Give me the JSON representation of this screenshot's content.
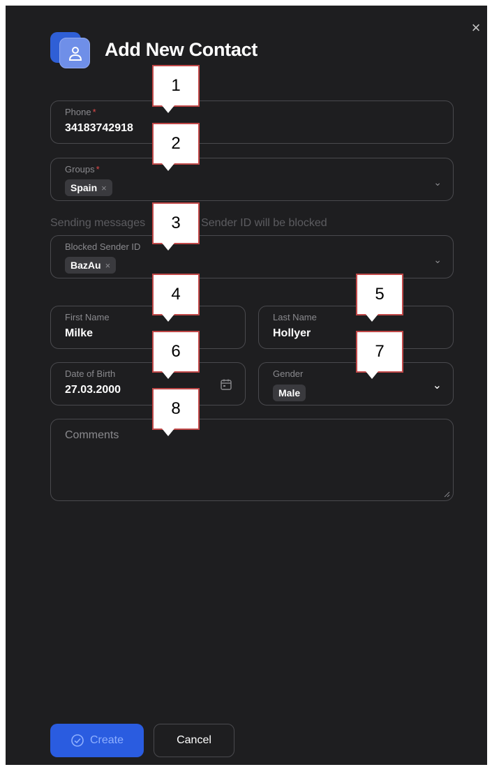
{
  "dialog": {
    "title": "Add New Contact",
    "close_glyph": "×",
    "logo_icon": "contact-user-icon"
  },
  "form": {
    "phone": {
      "label": "Phone",
      "required_mark": "*",
      "value": "34183742918"
    },
    "groups": {
      "label": "Groups",
      "required_mark": "*",
      "chips": [
        "Spain"
      ],
      "chip_remove": "×"
    },
    "blocked_note_left": "Sending messages",
    "blocked_note_right": "Sender ID will be blocked",
    "blocked_sender": {
      "label": "Blocked Sender ID",
      "chips": [
        "BazAu"
      ],
      "chip_remove": "×"
    },
    "first_name": {
      "label": "First Name",
      "value": "Milke"
    },
    "last_name": {
      "label": "Last Name",
      "value": "Hollyer"
    },
    "date_of_birth": {
      "label": "Date of Birth",
      "value": "27.03.2000"
    },
    "gender": {
      "label": "Gender",
      "value": "Male"
    },
    "comments": {
      "placeholder": "Comments"
    }
  },
  "actions": {
    "create_label": "Create",
    "cancel_label": "Cancel"
  },
  "callouts": [
    "1",
    "2",
    "3",
    "4",
    "5",
    "6",
    "7",
    "8"
  ],
  "colors": {
    "accent": "#2a5ce0",
    "required": "#e24a4a",
    "callout_border": "#c04848",
    "background": "#1e1e20"
  }
}
